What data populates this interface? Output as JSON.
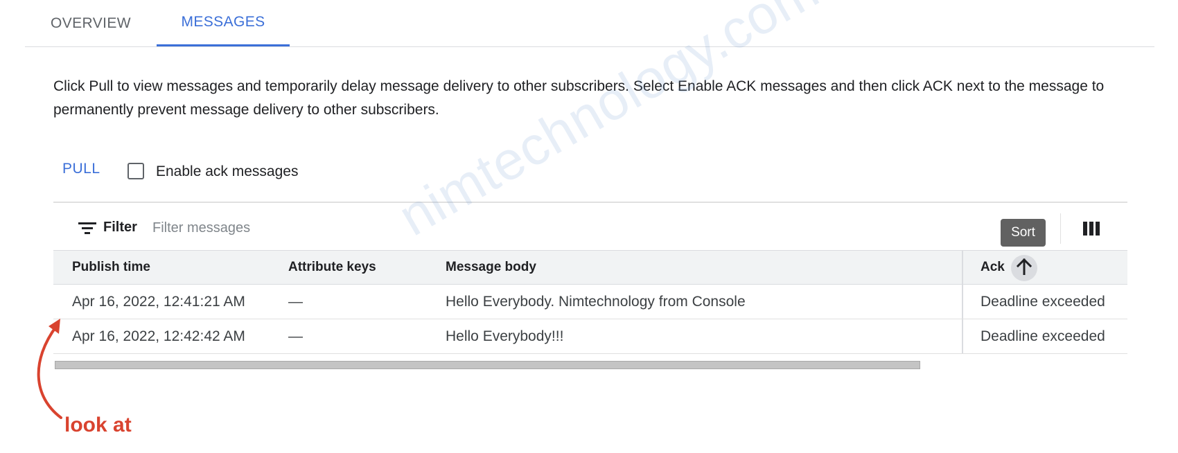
{
  "tabs": [
    {
      "label": "OVERVIEW"
    },
    {
      "label": "MESSAGES",
      "active": true
    }
  ],
  "description": "Click Pull to view messages and temporarily delay message delivery to other subscribers. Select Enable ACK messages and then click ACK next to the message to permanently prevent message delivery to other subscribers.",
  "actions": {
    "pull_label": "PULL",
    "enable_ack_label": "Enable ack messages",
    "enable_ack_checked": false
  },
  "filter": {
    "label": "Filter",
    "placeholder": "Filter messages",
    "value": ""
  },
  "tooltip": {
    "sort": "Sort"
  },
  "table": {
    "columns": [
      "Publish time",
      "Attribute keys",
      "Message body",
      "Ack"
    ],
    "rows": [
      {
        "publish_time": "Apr 16, 2022, 12:41:21 AM",
        "attribute_keys": "—",
        "message_body": "Hello Everybody. Nimtechnology from Console",
        "ack": "Deadline exceeded"
      },
      {
        "publish_time": "Apr 16, 2022, 12:42:42 AM",
        "attribute_keys": "—",
        "message_body": "Hello Everybody!!!",
        "ack": "Deadline exceeded"
      }
    ]
  },
  "watermark": "nimtechnology.com",
  "annotation": {
    "label": "look at",
    "color": "#d9432f"
  },
  "colors": {
    "accent": "#3b6fd8",
    "annotation": "#d9432f"
  },
  "icons": {
    "filter": "filter-icon",
    "columns": "columns-icon",
    "sort": "arrow-up-icon",
    "checkbox": "checkbox-unchecked-icon",
    "annotation_arrow": "curved-arrow-icon"
  }
}
